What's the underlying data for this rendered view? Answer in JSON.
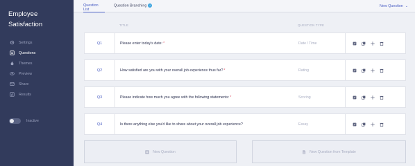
{
  "app": {
    "title": "Employee Satisfaction"
  },
  "sidebar": {
    "items": [
      {
        "label": "Settings",
        "icon": "gear-icon",
        "active": false
      },
      {
        "label": "Questions",
        "icon": "list-icon",
        "active": true
      },
      {
        "label": "Themes",
        "icon": "drop-icon",
        "active": false
      },
      {
        "label": "Preview",
        "icon": "eye-icon",
        "active": false
      },
      {
        "label": "Share",
        "icon": "share-icon",
        "active": false
      },
      {
        "label": "Results",
        "icon": "chart-icon",
        "active": false
      }
    ],
    "status_toggle": {
      "label": "Inactive",
      "on": false
    }
  },
  "tabs": {
    "question_list": "Question List",
    "question_branching": "Question Branching",
    "branching_badge": "✓",
    "new_question": "New Question"
  },
  "table": {
    "header_title": "TITLE",
    "header_type": "QUESTION TYPE",
    "rows": [
      {
        "num": "Q1",
        "text": "Please enter today's date:",
        "required": "*",
        "type": "Date / Time"
      },
      {
        "num": "Q2",
        "text": "How satisfied are you with your overall job experience thus far?",
        "required": "*",
        "type": "Rating"
      },
      {
        "num": "Q3",
        "text": "Please indicate how much you agree with the following statements:",
        "required": "*",
        "type": "Scoring"
      },
      {
        "num": "Q4",
        "text": "Is there anything else you'd like to share about your overall job experience?",
        "required": "",
        "type": "Essay"
      }
    ]
  },
  "add_buttons": {
    "new_question": "New Question",
    "from_template": "New Question from Template"
  },
  "colors": {
    "sidebar_bg": "#323b5c",
    "accent": "#4b5fc4",
    "required": "#e0566a",
    "badge": "#3fa6e0"
  }
}
